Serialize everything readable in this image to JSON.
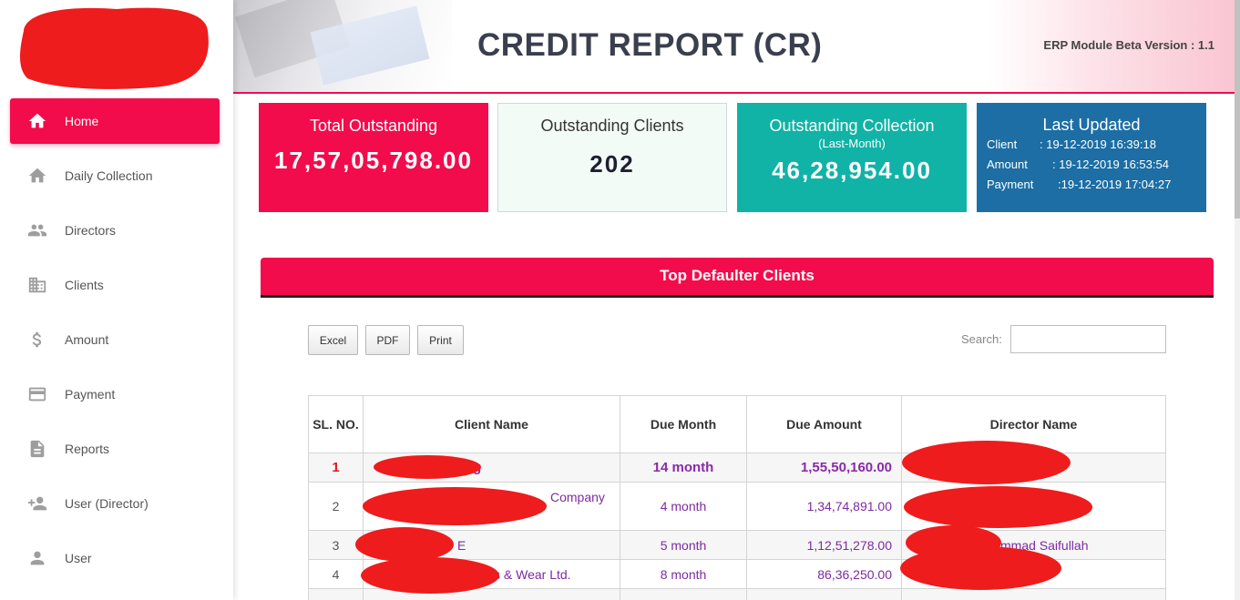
{
  "sidebar": {
    "items": [
      {
        "label": "Home",
        "icon": "home-icon",
        "active": true
      },
      {
        "label": "Daily Collection",
        "icon": "home-icon",
        "active": false
      },
      {
        "label": "Directors",
        "icon": "people-icon",
        "active": false
      },
      {
        "label": "Clients",
        "icon": "building-icon",
        "active": false
      },
      {
        "label": "Amount",
        "icon": "dollar-icon",
        "active": false
      },
      {
        "label": "Payment",
        "icon": "credit-card-icon",
        "active": false
      },
      {
        "label": "Reports",
        "icon": "document-icon",
        "active": false
      },
      {
        "label": "User (Director)",
        "icon": "add-user-icon",
        "active": false
      },
      {
        "label": "User",
        "icon": "person-icon",
        "active": false
      }
    ]
  },
  "header": {
    "title": "CREDIT REPORT (CR)",
    "version": "ERP Module Beta Version : 1.1"
  },
  "cards": {
    "total_outstanding": {
      "title": "Total Outstanding",
      "value": "17,57,05,798.00"
    },
    "outstanding_clients": {
      "title": "Outstanding Clients",
      "value": "202"
    },
    "outstanding_collection": {
      "title": "Outstanding Collection",
      "subtitle": "(Last-Month)",
      "value": "46,28,954.00"
    },
    "last_updated": {
      "title": "Last Updated",
      "client_label": "Client",
      "client_value": ": 19-12-2019 16:39:18",
      "amount_label": "Amount",
      "amount_value": ": 19-12-2019 16:53:54",
      "payment_label": "Payment",
      "payment_value": ":19-12-2019 17:04:27"
    }
  },
  "section": {
    "title": "Top Defaulter Clients"
  },
  "export": {
    "excel": "Excel",
    "pdf": "PDF",
    "print": "Print"
  },
  "search": {
    "label": "Search:",
    "value": ""
  },
  "table": {
    "headers": {
      "sl": "SL. NO.",
      "client": "Client Name",
      "due_month": "Due Month",
      "due_amount": "Due Amount",
      "director": "Director Name"
    },
    "rows": [
      {
        "sl": "1",
        "client": "g",
        "due_month": "14 month",
        "due_amount": "1,55,50,160.00",
        "director": ""
      },
      {
        "sl": "2",
        "client": "Company",
        "due_month": "4 month",
        "due_amount": "1,34,74,891.00",
        "director": ""
      },
      {
        "sl": "3",
        "client": "E",
        "due_month": "5 month",
        "due_amount": "1,12,51,278.00",
        "director": "mmad Saifullah"
      },
      {
        "sl": "4",
        "client": "s & Wear Ltd.",
        "due_month": "8 month",
        "due_amount": "86,36,250.00",
        "director": ""
      },
      {
        "sl": "",
        "client": "",
        "due_month": "",
        "due_amount": "",
        "director": ""
      }
    ]
  },
  "colors": {
    "accent": "#f20c4b",
    "teal": "#10b3a6",
    "blue": "#1c6ea4",
    "link_purple": "#7d2aa0"
  }
}
